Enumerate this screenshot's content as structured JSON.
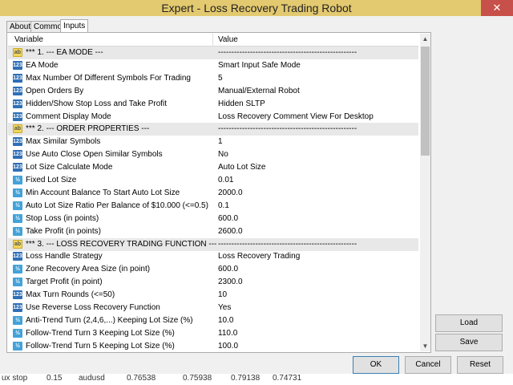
{
  "window": {
    "title": "Expert - Loss Recovery Trading Robot",
    "close_glyph": "✕"
  },
  "tabs": [
    "About",
    "Common",
    "Inputs"
  ],
  "table": {
    "headers": {
      "variable": "Variable",
      "value": "Value"
    },
    "rows": [
      {
        "icon": "ab",
        "name": "*** 1. --- EA MODE ---",
        "value": "----------------------------------------------------"
      },
      {
        "icon": "int",
        "name": "EA Mode",
        "value": "Smart Input Safe Mode"
      },
      {
        "icon": "int",
        "name": "Max Number Of Different Symbols For Trading",
        "value": "5"
      },
      {
        "icon": "int",
        "name": "Open Orders By",
        "value": "Manual/External Robot"
      },
      {
        "icon": "int",
        "name": "Hidden/Show Stop Loss and Take Profit",
        "value": "Hidden SLTP"
      },
      {
        "icon": "int",
        "name": "Comment Display Mode",
        "value": "Loss Recovery Comment View For Desktop"
      },
      {
        "icon": "ab",
        "name": "*** 2. --- ORDER PROPERTIES ---",
        "value": "----------------------------------------------------"
      },
      {
        "icon": "int",
        "name": "Max Similar Symbols",
        "value": "1"
      },
      {
        "icon": "int",
        "name": "Use Auto Close Open Similar Symbols",
        "value": "No"
      },
      {
        "icon": "int",
        "name": "Lot Size Calculate Mode",
        "value": "Auto Lot Size"
      },
      {
        "icon": "dbl",
        "name": "Fixed Lot Size",
        "value": "0.01"
      },
      {
        "icon": "dbl",
        "name": "Min Account Balance To Start Auto Lot Size",
        "value": "2000.0"
      },
      {
        "icon": "dbl",
        "name": "Auto Lot Size Ratio Per Balance of $10.000 (<=0.5)",
        "value": "0.1"
      },
      {
        "icon": "dbl",
        "name": "Stop Loss (in points)",
        "value": "600.0"
      },
      {
        "icon": "dbl",
        "name": "Take Profit (in points)",
        "value": "2600.0"
      },
      {
        "icon": "ab",
        "name": "*** 3. --- LOSS RECOVERY TRADING FUNCTION ---",
        "value": "----------------------------------------------------"
      },
      {
        "icon": "int",
        "name": "Loss Handle Strategy",
        "value": "Loss Recovery Trading"
      },
      {
        "icon": "dbl",
        "name": "Zone Recovery Area Size (in point)",
        "value": "600.0"
      },
      {
        "icon": "dbl",
        "name": "Target Profit (in point)",
        "value": "2300.0"
      },
      {
        "icon": "int",
        "name": "Max Turn Rounds (<=50)",
        "value": "10"
      },
      {
        "icon": "int",
        "name": "Use Reverse Loss Recovery Function",
        "value": "Yes"
      },
      {
        "icon": "dbl",
        "name": "Anti-Trend Turn (2,4,6,...) Keeping Lot Size (%)",
        "value": "10.0"
      },
      {
        "icon": "dbl",
        "name": "Follow-Trend Turn 3 Keeping Lot Size (%)",
        "value": "110.0"
      },
      {
        "icon": "dbl",
        "name": "Follow-Trend Turn 5 Keeping Lot Size (%)",
        "value": "100.0"
      }
    ],
    "icon_glyphs": {
      "ab": "ab",
      "int": "123",
      "dbl": "½"
    }
  },
  "side_buttons": {
    "load": "Load",
    "save": "Save"
  },
  "bottom_buttons": {
    "ok": "OK",
    "cancel": "Cancel",
    "reset": "Reset"
  },
  "background_strip": [
    "ux stop",
    "0.15",
    "audusd",
    "0.76538",
    "0.75938",
    "0.79138",
    "0.74731"
  ]
}
